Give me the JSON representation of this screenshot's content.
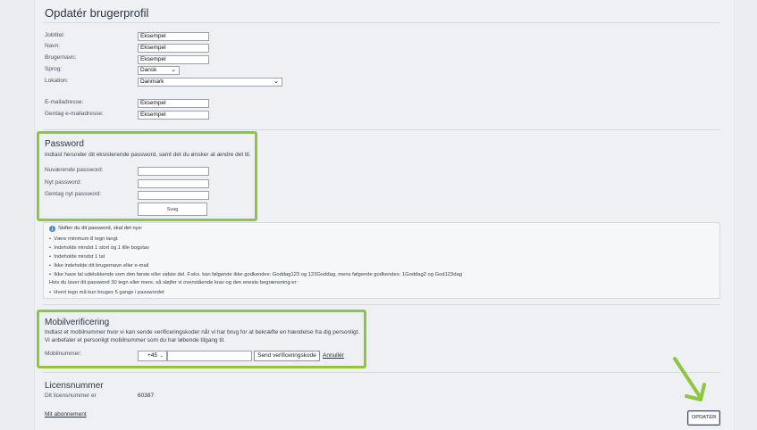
{
  "profile": {
    "title": "Opdatér brugerprofil",
    "jobtitle_label": "Jobtitel:",
    "jobtitle_value": "Eksempel",
    "name_label": "Navn:",
    "name_value": "Eksempel",
    "username_label": "Brugernavn:",
    "username_value": "Eksempel",
    "language_label": "Sprog:",
    "language_value": "Dansk",
    "location_label": "Lokation:",
    "location_value": "Danmark",
    "email_label": "E-mailadresse:",
    "email_value": "Eksempel",
    "email_repeat_label": "Gentag e-mailadresse:",
    "email_repeat_value": "Eksempel"
  },
  "password": {
    "title": "Password",
    "intro": "Indtast herunder dit eksisterende password, samt det du ønsker at ændre det til.",
    "current_label": "Nuværende password:",
    "new_label": "Nyt password:",
    "repeat_label": "Gentag nyt password:",
    "strength_label": "Svag"
  },
  "rules": {
    "heading": "Skifter du dit password, skal det nye:",
    "items": [
      "Være minimum 8 tegn langt",
      "Indeholde mindst 1 stort og 1 lille bogstav",
      "Indeholde mindst 1 tal",
      "Ikke indeholde dit brugernavn eller e-mail",
      "Ikke have tal udelukkende som den første eller sidste del. F.eks. kan følgende ikke godkendes: Goddag123 og 123Goddag, mens følgende godkendes: 1Goddag2 og God123dag"
    ],
    "long_note": "Hvis du laver dit password 30 tegn eller mere, så sløjfer vi ovenstående krav og den eneste begrænsning er:",
    "long_item": "Hvert tegn må kun bruges 5 gange i passwordet"
  },
  "mobile": {
    "title": "Mobilverificering",
    "intro1": "Indtast et mobilnummer hvor vi kan sende verificeringskoder når vi har brug for at bekræfte en hændelse fra dig personligt.",
    "intro2": "Vi anbefaler et personligt mobilnummer som du har løbende tilgang til.",
    "label": "Mobilnummer:",
    "country_code": "+45",
    "number_value": "",
    "send_label": "Send verificeringskode",
    "cancel_label": "Annullér"
  },
  "license": {
    "title": "Licensnummer",
    "label": "Dit licensnummer er",
    "value": "60387",
    "subscription_link": "Mit abonnement"
  },
  "actions": {
    "update_label": "OPDATÉR"
  },
  "colors": {
    "highlight": "#8ec640",
    "info_icon": "#3a8fd6"
  }
}
